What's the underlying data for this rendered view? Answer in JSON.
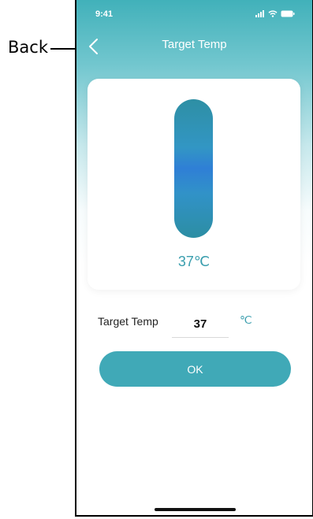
{
  "annotation": {
    "back_label": "Back"
  },
  "status_bar": {
    "time": "9:41"
  },
  "nav": {
    "title": "Target Temp",
    "back_icon": "chevron-left-icon"
  },
  "card": {
    "value_display": "37℃"
  },
  "form": {
    "label": "Target Temp",
    "value": "37",
    "unit": "℃"
  },
  "ok_button": {
    "label": "OK"
  },
  "colors": {
    "accent": "#40a9b7",
    "text_accent": "#3a9eae"
  }
}
